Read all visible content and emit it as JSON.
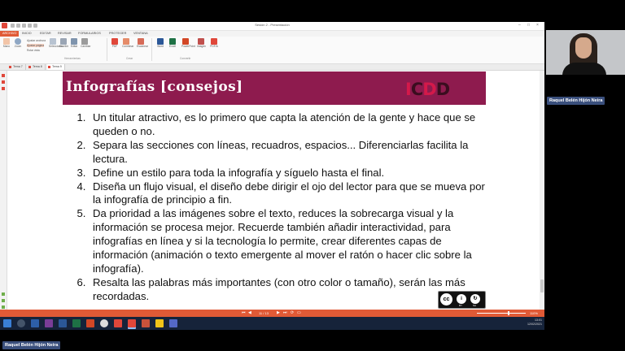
{
  "window": {
    "title": "Sesión 2 - Presentación",
    "ribbon_tabs": [
      "ARCHIVO",
      "INICIO",
      "EDITAR",
      "REVISAR",
      "FORMULARIOS",
      "PROTEGER",
      "VENTANA"
    ],
    "groups": [
      "Herramientas",
      "Crear",
      "Convertir"
    ],
    "buttons": [
      "Mano",
      "Zoom",
      "Seleccionar",
      "Escribir",
      "Editar",
      "Cambiar",
      "PDF",
      "Combinar",
      "Escanear",
      "Word",
      "Excel",
      "PowerPoint",
      "Imagen",
      "PDF/A"
    ],
    "small_buttons": [
      "Ajustar anchura",
      "Ajustar página",
      "Rotar vista"
    ]
  },
  "doc_tabs": [
    "Tema 7",
    "Tema 8",
    "Tema 9"
  ],
  "slide": {
    "title": "Infografías [consejos]",
    "logo": "ICDD",
    "tips": [
      "Un titular atractivo, es lo primero que capta la atención de la gente y hace que se queden o no.",
      "Separa las secciones con líneas, recuadros, espacios... Diferenciarlas facilita la lectura.",
      "Define un estilo para toda la infografía y síguelo hasta el final.",
      "Diseña un flujo visual, el diseño debe dirigir el ojo del lector para que se mueva por la infografía de principio a fin.",
      "Da prioridad a las imágenes sobre el texto, reduces la sobrecarga visual y la información se procesa mejor. Recuerde también añadir interactividad, para infografías en línea y si la tecnología lo permite, crear diferentes capas de información (animación o texto emergente al mover el ratón o hacer clic sobre la infografía).",
      "Resalta las palabras más importantes (con otro color o tamaño), serán las más recordadas."
    ],
    "license": {
      "cc": "cc",
      "by": "BY",
      "sa": "SA"
    }
  },
  "status": {
    "page": "11 / 13",
    "zoom": "110%"
  },
  "tray": {
    "time": "13:01",
    "date": "12/02/2021"
  },
  "participant": {
    "name": "Raquel Belén Hijón Neira"
  },
  "colors": {
    "banner": "#8e1b4e",
    "accent": "#e05a36",
    "logo_red": "#d3194a"
  }
}
